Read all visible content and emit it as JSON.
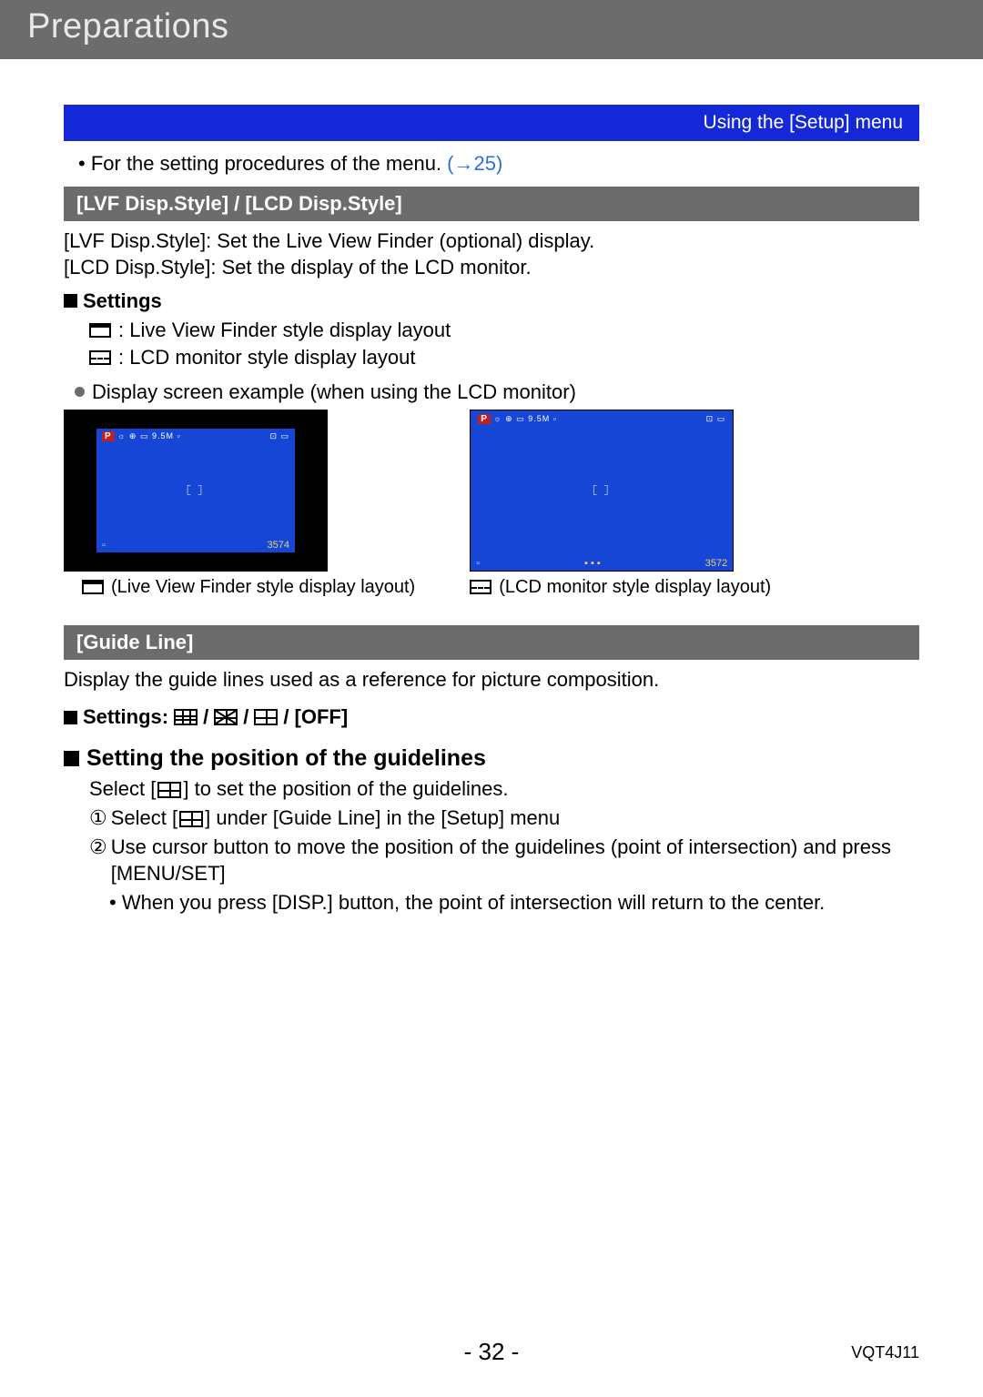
{
  "header": {
    "title": "Preparations"
  },
  "blueBar": {
    "right": "Using the [Setup] menu"
  },
  "intro": {
    "text": "For the setting procedures of the menu. ",
    "link": "(→25)"
  },
  "section1": {
    "title": "[LVF Disp.Style] / [LCD Disp.Style]",
    "desc1": "[LVF Disp.Style]: Set the Live View Finder (optional) display.",
    "desc2": "[LCD Disp.Style]: Set the display of the LCD monitor.",
    "settingsLabel": "Settings",
    "opt1": ": Live View Finder style display layout",
    "opt2": ": LCD monitor style display layout",
    "exampleLine": "Display screen example (when using the LCD monitor)",
    "caption1": "(Live View Finder style display layout)",
    "caption2": "(LCD monitor style display layout)",
    "osd": {
      "counter1": "3574",
      "counter2": "3572",
      "p": "P",
      "res": "9.5M"
    }
  },
  "section2": {
    "title": "[Guide Line]",
    "desc": "Display the guide lines used as a reference for picture composition.",
    "settingsPrefix": "Settings: ",
    "slash": " / ",
    "off": " [OFF]",
    "heading": "Setting the position of the guidelines",
    "line1a": "Select [",
    "line1b": "] to set the position of the guidelines.",
    "step1a": "Select [",
    "step1b": "] under [Guide Line] in the [Setup] menu",
    "step2": "Use cursor button to move the position of the guidelines (point of intersection) and press [MENU/SET]",
    "note": "When you press [DISP.] button, the point of intersection will return to the center.",
    "num1": "①",
    "num2": "②"
  },
  "footer": {
    "page": "- 32 -",
    "docId": "VQT4J11"
  }
}
